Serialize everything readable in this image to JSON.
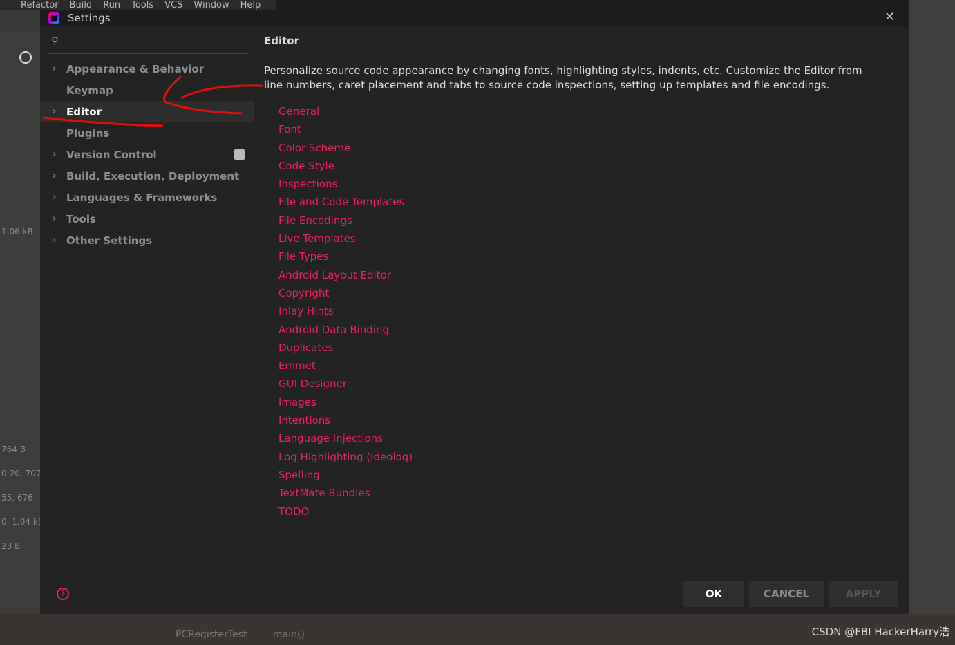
{
  "background": {
    "menu": [
      "Refactor",
      "Build",
      "Run",
      "Tools",
      "VCS",
      "Window",
      "Help"
    ],
    "side_texts": [
      "1.06 kB",
      "764 B",
      "0:20, 707",
      "55, 676",
      "0, 1.04 kB",
      "23 B"
    ],
    "breadcrumb": [
      "PCRegisterTest",
      "main()"
    ],
    "watermark": "CSDN @FBI HackerHarry浩"
  },
  "dialog": {
    "title": "Settings",
    "close_icon": "close-icon"
  },
  "sidebar": {
    "search_placeholder": "",
    "items": [
      {
        "label": "Appearance & Behavior",
        "expandable": true
      },
      {
        "label": "Keymap",
        "expandable": false
      },
      {
        "label": "Editor",
        "expandable": true,
        "selected": true
      },
      {
        "label": "Plugins",
        "expandable": false
      },
      {
        "label": "Version Control",
        "expandable": true
      },
      {
        "label": "Build, Execution, Deployment",
        "expandable": true
      },
      {
        "label": "Languages & Frameworks",
        "expandable": true
      },
      {
        "label": "Tools",
        "expandable": true
      },
      {
        "label": "Other Settings",
        "expandable": true
      }
    ]
  },
  "main": {
    "heading": "Editor",
    "description": "Personalize source code appearance by changing fonts, highlighting styles, indents, etc. Customize the Editor from line numbers, caret placement and tabs to source code inspections, setting up templates and file encodings.",
    "links": [
      "General",
      "Font",
      "Color Scheme",
      "Code Style",
      "Inspections",
      "File and Code Templates",
      "File Encodings",
      "Live Templates",
      "File Types",
      "Android Layout Editor",
      "Copyright",
      "Inlay Hints",
      "Android Data Binding",
      "Duplicates",
      "Emmet",
      "GUI Designer",
      "Images",
      "Intentions",
      "Language Injections",
      "Log Highlighting (Ideolog)",
      "Spelling",
      "TextMate Bundles",
      "TODO"
    ]
  },
  "buttons": {
    "ok": "OK",
    "cancel": "CANCEL",
    "apply": "APPLY"
  },
  "colors": {
    "link": "#e8245a",
    "annotation": "#e01010"
  }
}
